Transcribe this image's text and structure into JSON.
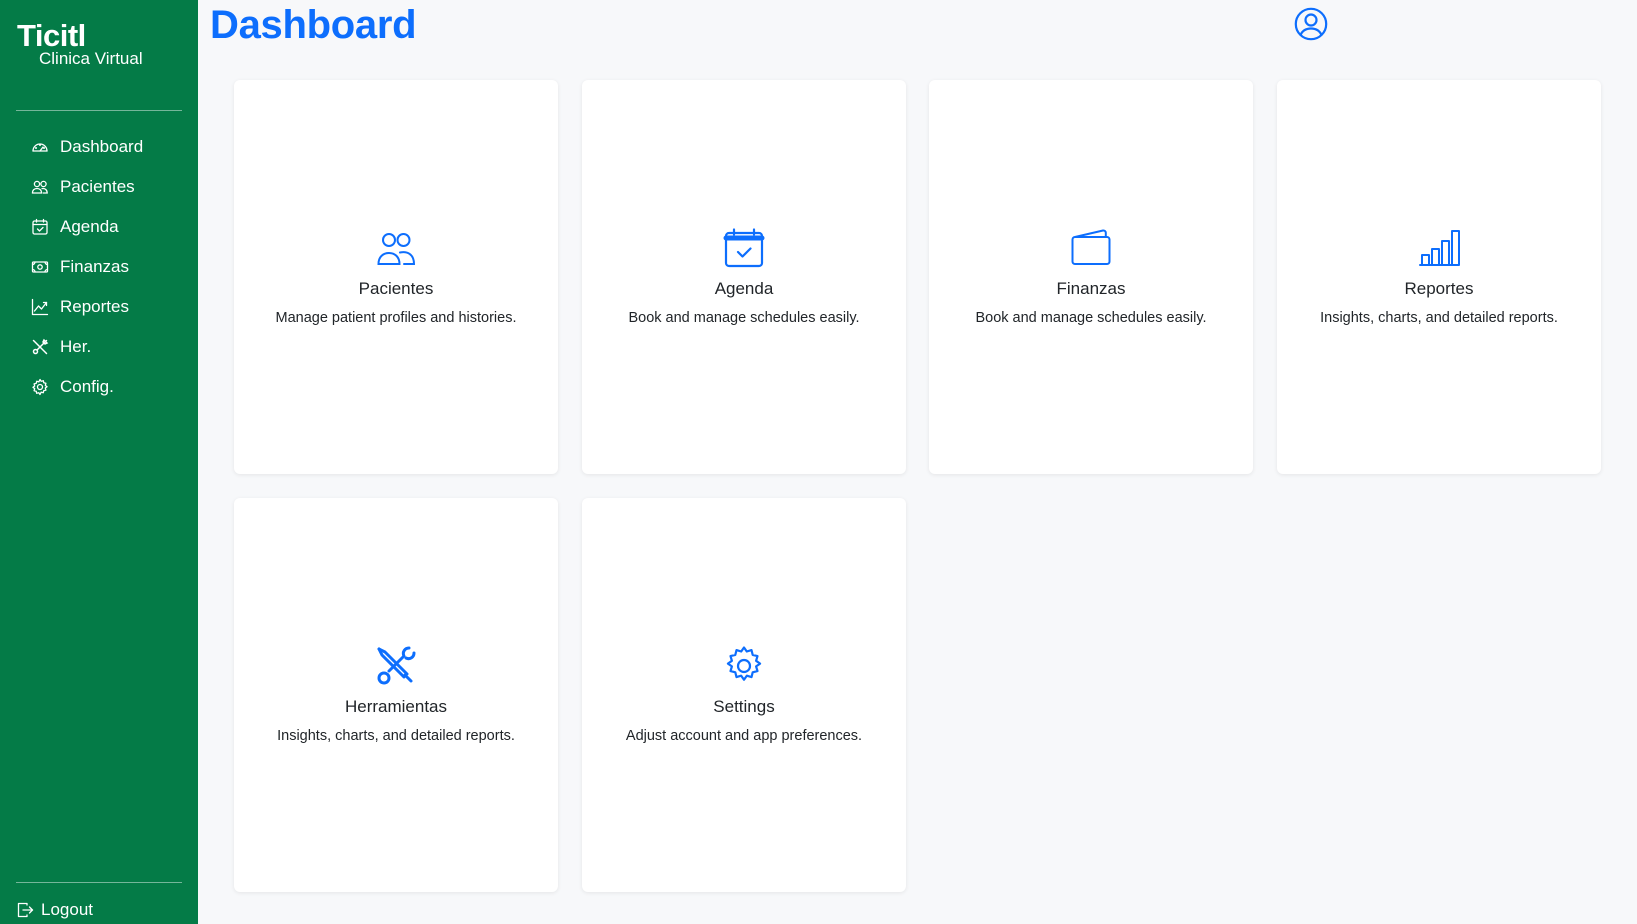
{
  "sidebar": {
    "brand_title": "Ticitl",
    "brand_subtitle": "Clinica Virtual",
    "items": [
      {
        "label": "Dashboard",
        "icon": "speedometer-icon"
      },
      {
        "label": "Pacientes",
        "icon": "people-icon"
      },
      {
        "label": "Agenda",
        "icon": "calendar-check-icon"
      },
      {
        "label": "Finanzas",
        "icon": "cash-icon"
      },
      {
        "label": "Reportes",
        "icon": "graph-up-icon"
      },
      {
        "label": "Her.",
        "icon": "tools-icon"
      },
      {
        "label": "Config.",
        "icon": "gear-icon"
      }
    ],
    "logout_label": "Logout"
  },
  "header": {
    "title": "Dashboard",
    "user_icon": "person-circle-icon"
  },
  "cards": [
    {
      "title": "Pacientes",
      "description": "Manage patient profiles and histories.",
      "icon": "people-icon"
    },
    {
      "title": "Agenda",
      "description": "Book and manage schedules easily.",
      "icon": "calendar-check-icon"
    },
    {
      "title": "Finanzas",
      "description": "Book and manage schedules easily.",
      "icon": "wallet-icon"
    },
    {
      "title": "Reportes",
      "description": "Insights, charts, and detailed reports.",
      "icon": "bar-chart-icon"
    },
    {
      "title": "Herramientas",
      "description": "Insights, charts, and detailed reports.",
      "icon": "tools-icon"
    },
    {
      "title": "Settings",
      "description": "Adjust account and app preferences.",
      "icon": "gear-icon"
    }
  ],
  "colors": {
    "sidebar_bg": "#047b47",
    "accent": "#0d6efd",
    "page_bg": "#f7f8fa"
  }
}
